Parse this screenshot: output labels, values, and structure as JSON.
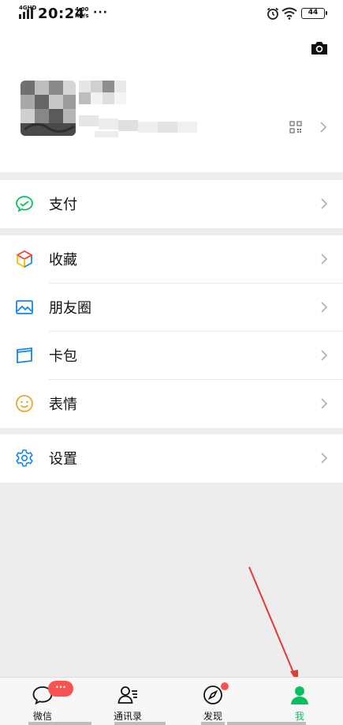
{
  "status_bar": {
    "network": "4GHD",
    "time": "20:24",
    "speed_value": "4.00",
    "speed_unit": "KB/s",
    "battery": "44",
    "more_dots": "···"
  },
  "profile": {
    "camera_icon": "camera-icon",
    "qr_icon": "qr-code-icon"
  },
  "menu": {
    "pay": {
      "label": "支付",
      "icon": "wechat-pay-icon",
      "color": "#07c160"
    },
    "favorites": {
      "label": "收藏",
      "icon": "cube-icon"
    },
    "moments": {
      "label": "朋友圈",
      "icon": "image-icon",
      "color": "#1485ee"
    },
    "cards": {
      "label": "卡包",
      "icon": "card-icon",
      "color": "#1485ee"
    },
    "stickers": {
      "label": "表情",
      "icon": "smile-icon",
      "color": "#f0a72f"
    },
    "settings": {
      "label": "设置",
      "icon": "gear-icon",
      "color": "#1485ee"
    }
  },
  "tabbar": {
    "chats": {
      "label": "微信",
      "badge": "···"
    },
    "contacts": {
      "label": "通讯录"
    },
    "discover": {
      "label": "发现"
    },
    "me": {
      "label": "我",
      "active_color": "#07c160"
    }
  },
  "colors": {
    "accent": "#07c160",
    "badge": "#fa5151",
    "annotation_arrow": "#e53935"
  }
}
